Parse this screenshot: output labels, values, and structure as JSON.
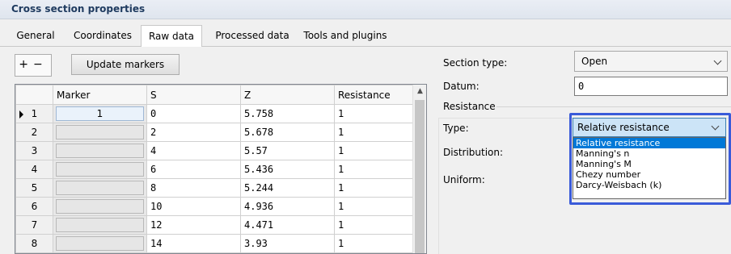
{
  "window": {
    "title": "Cross section properties"
  },
  "tabs": [
    {
      "label": "General"
    },
    {
      "label": "Coordinates"
    },
    {
      "label": "Raw data",
      "active": true
    },
    {
      "label": "Processed data"
    },
    {
      "label": "Tools and plugins"
    }
  ],
  "toolbar": {
    "add_label": "+",
    "remove_label": "−",
    "update_markers_label": "Update markers"
  },
  "grid": {
    "columns": [
      "Marker",
      "S",
      "Z",
      "Resistance"
    ],
    "rows": [
      {
        "num": "1",
        "marker": "1",
        "s": "0",
        "z": "5.758",
        "resistance": "1"
      },
      {
        "num": "2",
        "marker": "",
        "s": "2",
        "z": "5.678",
        "resistance": "1"
      },
      {
        "num": "3",
        "marker": "",
        "s": "4",
        "z": "5.57",
        "resistance": "1"
      },
      {
        "num": "4",
        "marker": "",
        "s": "6",
        "z": "5.436",
        "resistance": "1"
      },
      {
        "num": "5",
        "marker": "",
        "s": "8",
        "z": "5.244",
        "resistance": "1"
      },
      {
        "num": "6",
        "marker": "",
        "s": "10",
        "z": "4.936",
        "resistance": "1"
      },
      {
        "num": "7",
        "marker": "",
        "s": "12",
        "z": "4.471",
        "resistance": "1"
      },
      {
        "num": "8",
        "marker": "",
        "s": "14",
        "z": "3.93",
        "resistance": "1"
      }
    ]
  },
  "section": {
    "section_type_label": "Section type:",
    "section_type_value": "Open",
    "datum_label": "Datum:",
    "datum_value": "0",
    "resistance_group_label": "Resistance",
    "type_label": "Type:",
    "type_value": "Relative resistance",
    "distribution_label": "Distribution:",
    "uniform_label": "Uniform:",
    "type_options": [
      "Relative resistance",
      "Manning's n",
      "Manning's M",
      "Chezy number",
      "Darcy-Weisbach (k)"
    ]
  },
  "colors": {
    "highlight": "#3a5bd9",
    "selection": "#0078d7",
    "title_text": "#1e3a5f"
  }
}
